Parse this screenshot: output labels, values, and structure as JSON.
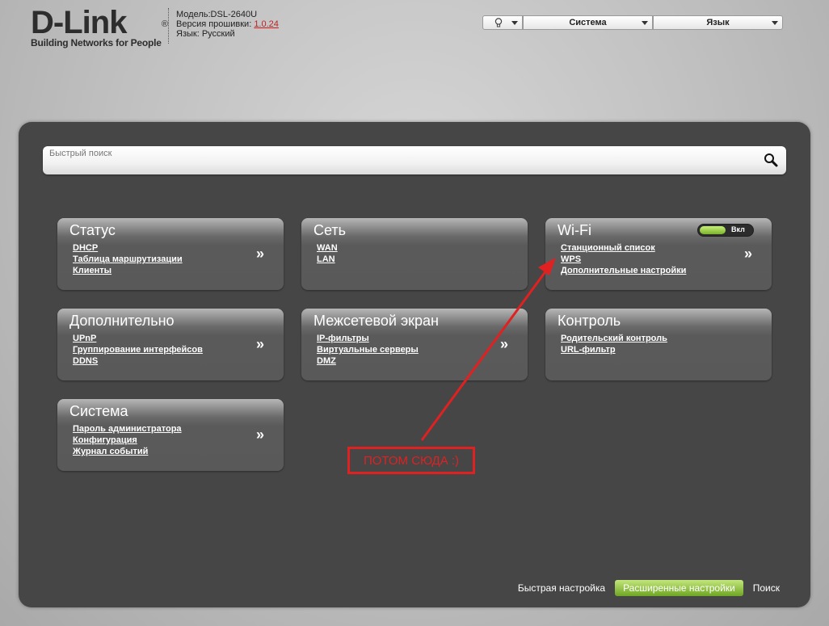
{
  "header": {
    "logo_main": "D-Link",
    "logo_reg": "®",
    "logo_tagline": "Building Networks for People",
    "model_label": "Модель:",
    "model_value": "DSL-2640U",
    "firmware_label": "Версия прошивки:",
    "firmware_value": "1.0.24",
    "language_label": "Язык:",
    "language_value": "Русский"
  },
  "top_controls": {
    "system_label": "Система",
    "language_label": "Язык"
  },
  "search": {
    "placeholder": "Быстрый поиск"
  },
  "cards": {
    "status": {
      "title": "Статус",
      "links": [
        "DHCP",
        "Таблица маршрутизации",
        "Клиенты"
      ],
      "more": "»"
    },
    "network": {
      "title": "Сеть",
      "links": [
        "WAN",
        "LAN"
      ]
    },
    "wifi": {
      "title": "Wi-Fi",
      "links": [
        "Станционный список",
        "WPS",
        "Дополнительные настройки"
      ],
      "more": "»",
      "toggle_label": "Вкл",
      "toggle_on": true
    },
    "advanced": {
      "title": "Дополнительно",
      "links": [
        "UPnP",
        "Группирование интерфейсов",
        "DDNS"
      ],
      "more": "»"
    },
    "firewall": {
      "title": "Межсетевой экран",
      "links": [
        "IP-фильтры",
        "Виртуальные серверы",
        "DMZ"
      ],
      "more": "»"
    },
    "control": {
      "title": "Контроль",
      "links": [
        "Родительский контроль",
        "URL-фильтр"
      ]
    },
    "system": {
      "title": "Система",
      "links": [
        "Пароль администратора",
        "Конфигурация",
        "Журнал событий"
      ],
      "more": "»"
    }
  },
  "bottom_nav": {
    "quick_setup": "Быстрая настройка",
    "advanced_settings": "Расширенные настройки",
    "search": "Поиск"
  },
  "annotation": {
    "text": "ПОТОМ СЮДА :)"
  },
  "colors": {
    "accent_green": "#7bb32a",
    "annotation_red": "#e02121",
    "panel_bg": "#464646"
  }
}
